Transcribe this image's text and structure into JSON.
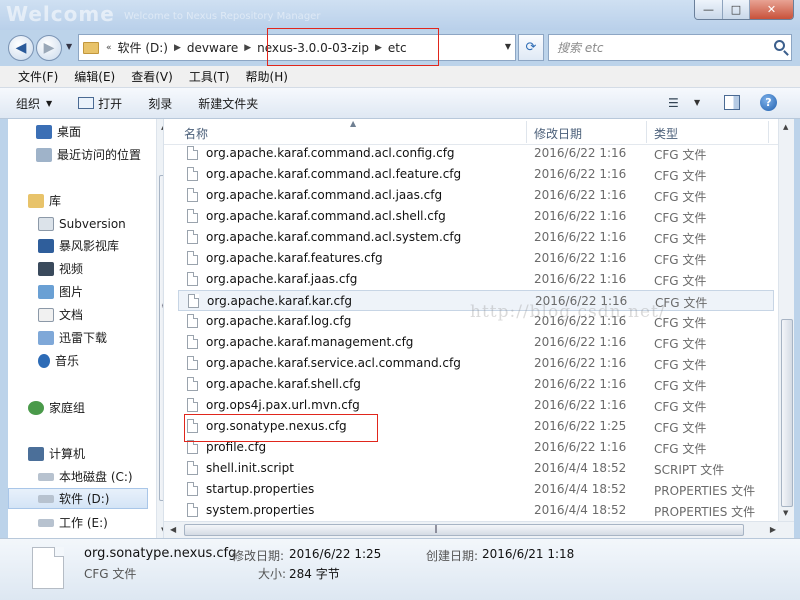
{
  "window": {
    "title": "Welcome",
    "title_sub": "Welcome to Nexus Repository Manager",
    "buttons": [
      "—",
      "□",
      "✕"
    ]
  },
  "address": {
    "crumbs": [
      "软件 (D:)",
      "devware",
      "nexus-3.0.0-03-zip",
      "etc"
    ],
    "overflow": "«",
    "search_placeholder": "搜索 etc"
  },
  "menu": [
    "文件(F)",
    "编辑(E)",
    "查看(V)",
    "工具(T)",
    "帮助(H)"
  ],
  "toolbar": {
    "organize": "组织",
    "open": "打开",
    "burn": "刻录",
    "new_folder": "新建文件夹"
  },
  "nav": {
    "items": [
      {
        "label": "桌面",
        "icon": "desktop-icon"
      },
      {
        "label": "最近访问的位置",
        "icon": "recent-places-icon"
      },
      {
        "label": "库",
        "icon": "libraries-icon"
      },
      {
        "label": "Subversion",
        "icon": "subversion-icon"
      },
      {
        "label": "暴风影视库",
        "icon": "storm-video-icon"
      },
      {
        "label": "视频",
        "icon": "video-icon"
      },
      {
        "label": "图片",
        "icon": "pictures-icon"
      },
      {
        "label": "文档",
        "icon": "documents-icon"
      },
      {
        "label": "迅雷下载",
        "icon": "thunder-download-icon"
      },
      {
        "label": "音乐",
        "icon": "music-icon"
      },
      {
        "label": "家庭组",
        "icon": "homegroup-icon"
      },
      {
        "label": "计算机",
        "icon": "computer-icon"
      },
      {
        "label": "本地磁盘 (C:)",
        "icon": "drive-icon"
      },
      {
        "label": "软件 (D:)",
        "icon": "drive-icon"
      },
      {
        "label": "工作 (E:)",
        "icon": "drive-icon"
      }
    ]
  },
  "columns": {
    "name": "名称",
    "date": "修改日期",
    "type": "类型"
  },
  "files": [
    {
      "name": "org.apache.karaf.command.acl.config.cfg",
      "date": "2016/6/22 1:16",
      "type": "CFG 文件"
    },
    {
      "name": "org.apache.karaf.command.acl.feature.cfg",
      "date": "2016/6/22 1:16",
      "type": "CFG 文件"
    },
    {
      "name": "org.apache.karaf.command.acl.jaas.cfg",
      "date": "2016/6/22 1:16",
      "type": "CFG 文件"
    },
    {
      "name": "org.apache.karaf.command.acl.shell.cfg",
      "date": "2016/6/22 1:16",
      "type": "CFG 文件"
    },
    {
      "name": "org.apache.karaf.command.acl.system.cfg",
      "date": "2016/6/22 1:16",
      "type": "CFG 文件"
    },
    {
      "name": "org.apache.karaf.features.cfg",
      "date": "2016/6/22 1:16",
      "type": "CFG 文件"
    },
    {
      "name": "org.apache.karaf.jaas.cfg",
      "date": "2016/6/22 1:16",
      "type": "CFG 文件"
    },
    {
      "name": "org.apache.karaf.kar.cfg",
      "date": "2016/6/22 1:16",
      "type": "CFG 文件"
    },
    {
      "name": "org.apache.karaf.log.cfg",
      "date": "2016/6/22 1:16",
      "type": "CFG 文件"
    },
    {
      "name": "org.apache.karaf.management.cfg",
      "date": "2016/6/22 1:16",
      "type": "CFG 文件"
    },
    {
      "name": "org.apache.karaf.service.acl.command.cfg",
      "date": "2016/6/22 1:16",
      "type": "CFG 文件"
    },
    {
      "name": "org.apache.karaf.shell.cfg",
      "date": "2016/6/22 1:16",
      "type": "CFG 文件"
    },
    {
      "name": "org.ops4j.pax.url.mvn.cfg",
      "date": "2016/6/22 1:16",
      "type": "CFG 文件"
    },
    {
      "name": "org.sonatype.nexus.cfg",
      "date": "2016/6/22 1:25",
      "type": "CFG 文件"
    },
    {
      "name": "profile.cfg",
      "date": "2016/6/22 1:16",
      "type": "CFG 文件"
    },
    {
      "name": "shell.init.script",
      "date": "2016/4/4 18:52",
      "type": "SCRIPT 文件"
    },
    {
      "name": "startup.properties",
      "date": "2016/4/4 18:52",
      "type": "PROPERTIES 文件"
    },
    {
      "name": "system.properties",
      "date": "2016/4/4 18:52",
      "type": "PROPERTIES 文件"
    }
  ],
  "watermark": "http://blog.csdn.net/",
  "details": {
    "name": "org.sonatype.nexus.cfg",
    "type": "CFG 文件",
    "modified_label": "修改日期:",
    "modified": "2016/6/22 1:25",
    "created_label": "创建日期:",
    "created": "2016/6/21 1:18",
    "size_label": "大小:",
    "size": "284 字节"
  },
  "colors": {
    "highlight_box": "#e0261c",
    "folder": "#e8c36a"
  }
}
